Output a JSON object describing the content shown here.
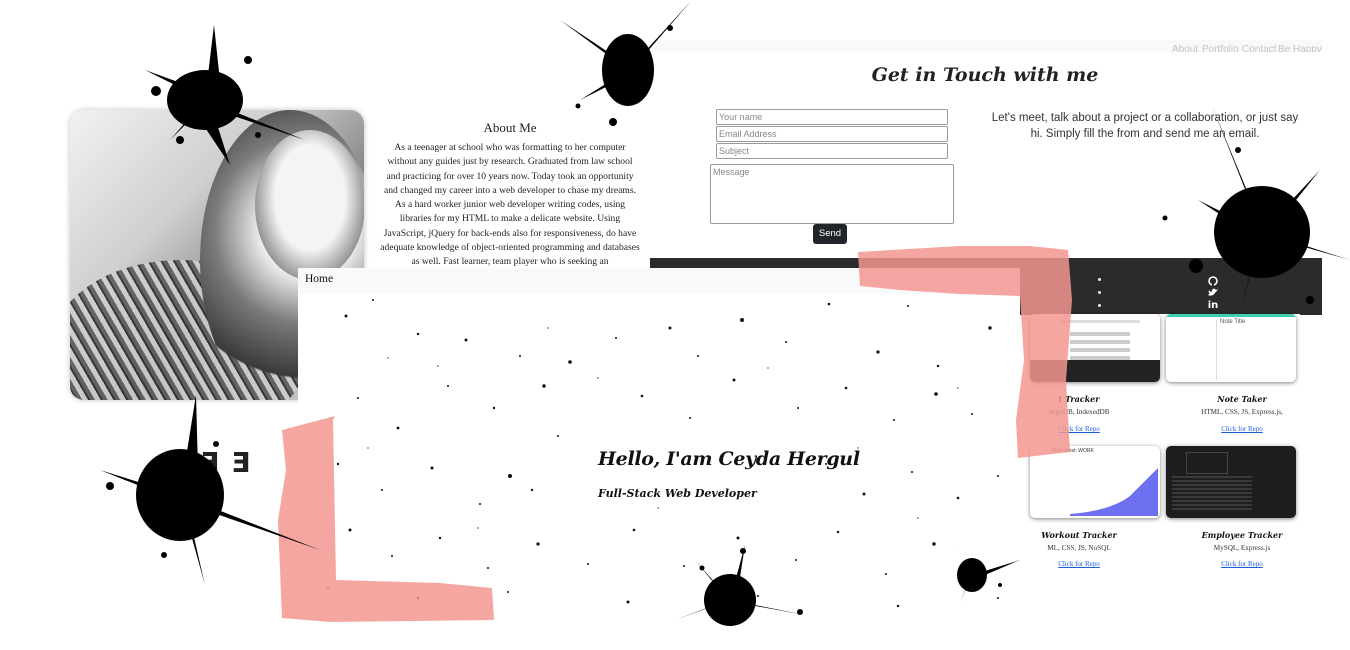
{
  "about": {
    "title": "About Me",
    "text": "As a teenager at school who was formatting to her computer without any guides just by research. Graduated from law school and practicing for over 10 years now. Today took an opportunity and changed my career into a web developer to chase my dreams. As a hard worker junior web developer writing codes, using libraries for my HTML to make a delicate website. Using JavaScript, jQuery for back-ends also for responsiveness, do have adequate knowledge of object-oriented programming and databases as well. Fast learner, team player who is seeking an"
  },
  "contact": {
    "title": "Get in Touch with me",
    "name_placeholder": "Your name",
    "email_placeholder": "Email Address",
    "subject_placeholder": "Subject",
    "message_placeholder": "Message",
    "send_label": "Send",
    "blurb": "Let's meet, talk about a project or a collaboration, or just say hi. Simply fill the from and send me an email.",
    "nav_items": [
      "Home",
      "About",
      "Portfolio",
      "Contact",
      "Be Happy"
    ]
  },
  "footer": {
    "icons": [
      "github-icon",
      "twitter-icon",
      "linkedin-icon"
    ]
  },
  "portfolio": {
    "cards": [
      {
        "title": "t Tracker",
        "tech": "ongoDB, IndexedDB",
        "link": "Click for Repo"
      },
      {
        "title": "Note Taker",
        "tech": "HTML, CSS, JS, Express.js,",
        "link": "Click for Repo"
      },
      {
        "title": "Workout Tracker",
        "tech": "ML, CSS, JS, NoSQL",
        "link": "Click for Repo"
      },
      {
        "title": "Employee Tracker",
        "tech": "MySQL, Express.js",
        "link": "Click for Repo"
      }
    ]
  },
  "hero": {
    "nav_home": "Home",
    "title": "Hello, I'am Ceyda Hergul",
    "subtitle": "Full-Stack Web Developer"
  },
  "colors": {
    "brush": "#f3968f",
    "ink": "#000000",
    "footer": "#2b2b2b",
    "button": "#212529",
    "link": "#1a5fd6"
  }
}
